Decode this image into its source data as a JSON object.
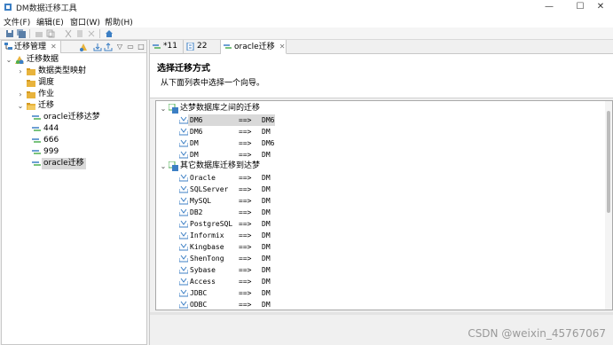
{
  "window": {
    "title": "DM数据迁移工具"
  },
  "menu": [
    "文件(F)",
    "编辑(E)",
    "窗口(W)",
    "帮助(H)"
  ],
  "left_pane": {
    "tab_label": "迁移管理",
    "tree": {
      "root": "迁移数据",
      "children": [
        "数据类型映射",
        "调度",
        "作业",
        "迁移"
      ],
      "jobs": [
        "oracle迁移达梦",
        "444",
        "666",
        "999",
        "oracle迁移"
      ]
    }
  },
  "editor": {
    "tabs": [
      "*11",
      "22",
      "oracle迁移"
    ],
    "wizard_title": "选择迁移方式",
    "wizard_desc": "从下面列表中选择一个向导。",
    "group1": {
      "label": "达梦数据库之间的迁移",
      "rows": [
        {
          "src": "DM6",
          "arrow": "==>",
          "dst": "DM6"
        },
        {
          "src": "DM6",
          "arrow": "==>",
          "dst": "DM"
        },
        {
          "src": "DM",
          "arrow": "==>",
          "dst": "DM6"
        },
        {
          "src": "DM",
          "arrow": "==>",
          "dst": "DM"
        }
      ]
    },
    "group2": {
      "label": "其它数据库迁移到达梦",
      "rows": [
        {
          "src": "Oracle",
          "arrow": "==>",
          "dst": "DM"
        },
        {
          "src": "SQLServer",
          "arrow": "==>",
          "dst": "DM"
        },
        {
          "src": "MySQL",
          "arrow": "==>",
          "dst": "DM"
        },
        {
          "src": "DB2",
          "arrow": "==>",
          "dst": "DM"
        },
        {
          "src": "PostgreSQL",
          "arrow": "==>",
          "dst": "DM"
        },
        {
          "src": "Informix",
          "arrow": "==>",
          "dst": "DM"
        },
        {
          "src": "Kingbase",
          "arrow": "==>",
          "dst": "DM"
        },
        {
          "src": "ShenTong",
          "arrow": "==>",
          "dst": "DM"
        },
        {
          "src": "Sybase",
          "arrow": "==>",
          "dst": "DM"
        },
        {
          "src": "Access",
          "arrow": "==>",
          "dst": "DM"
        },
        {
          "src": "JDBC",
          "arrow": "==>",
          "dst": "DM"
        },
        {
          "src": "ODBC",
          "arrow": "==>",
          "dst": "DM"
        }
      ]
    }
  },
  "watermark": "CSDN @weixin_45767067",
  "colors": {
    "selection": "#d9d9d9",
    "folder": "#e8b33c",
    "db_icon": "#3c7fc4"
  }
}
